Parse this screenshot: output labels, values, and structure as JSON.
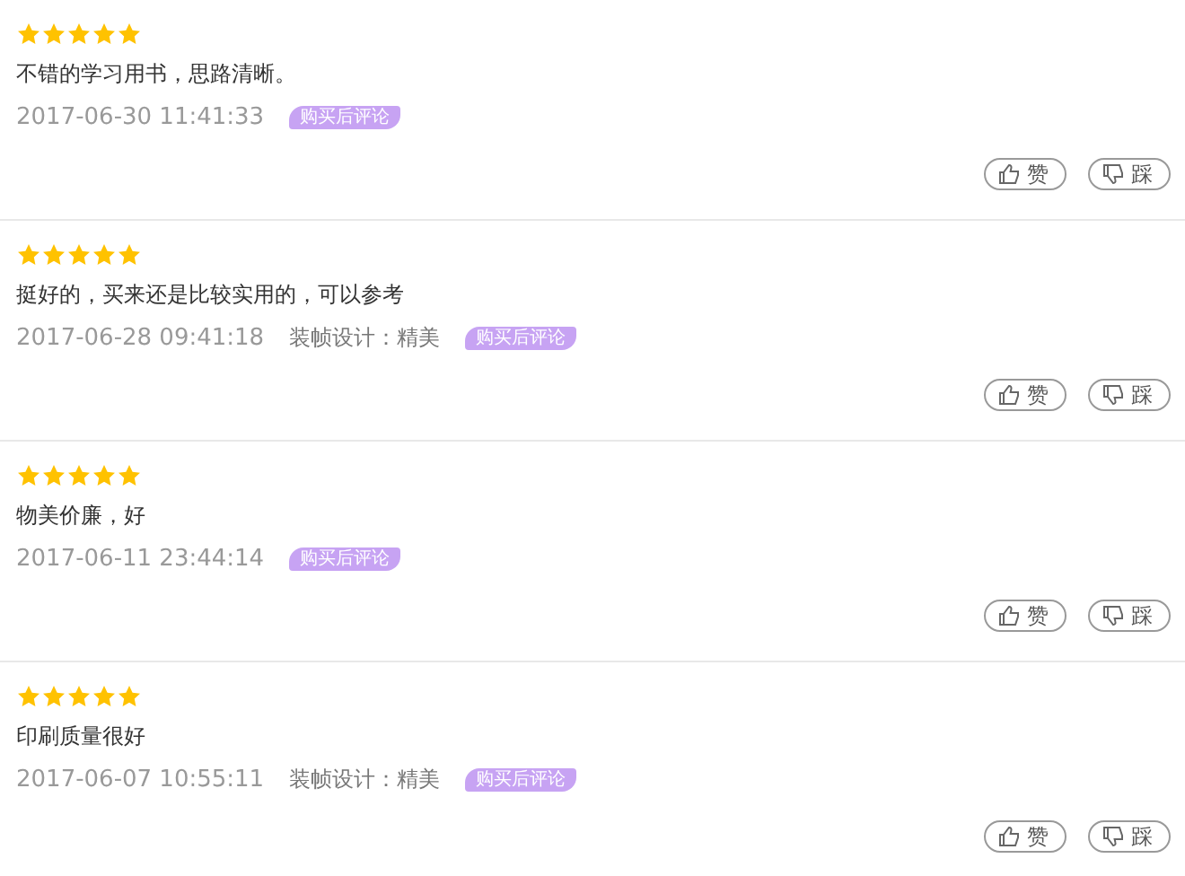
{
  "reviews": [
    {
      "stars": 5,
      "text": "不错的学习用书，思路清晰。",
      "time": "2017-06-30 11:41:33",
      "badge": "购买后评论",
      "like": "赞",
      "dislike": "踩"
    },
    {
      "stars": 5,
      "text": "挺好的，买来还是比较实用的，可以参考",
      "time": "2017-06-28 09:41:18",
      "detail": "装帧设计：精美",
      "badge": "购买后评论",
      "like": "赞",
      "dislike": "踩"
    },
    {
      "stars": 5,
      "text": "物美价廉，好",
      "time": "2017-06-11 23:44:14",
      "badge": "购买后评论",
      "like": "赞",
      "dislike": "踩"
    },
    {
      "stars": 5,
      "text": "印刷质量很好",
      "time": "2017-06-07 10:55:11",
      "detail": "装帧设计：精美",
      "badge": "购买后评论",
      "like": "赞",
      "dislike": "踩"
    }
  ]
}
